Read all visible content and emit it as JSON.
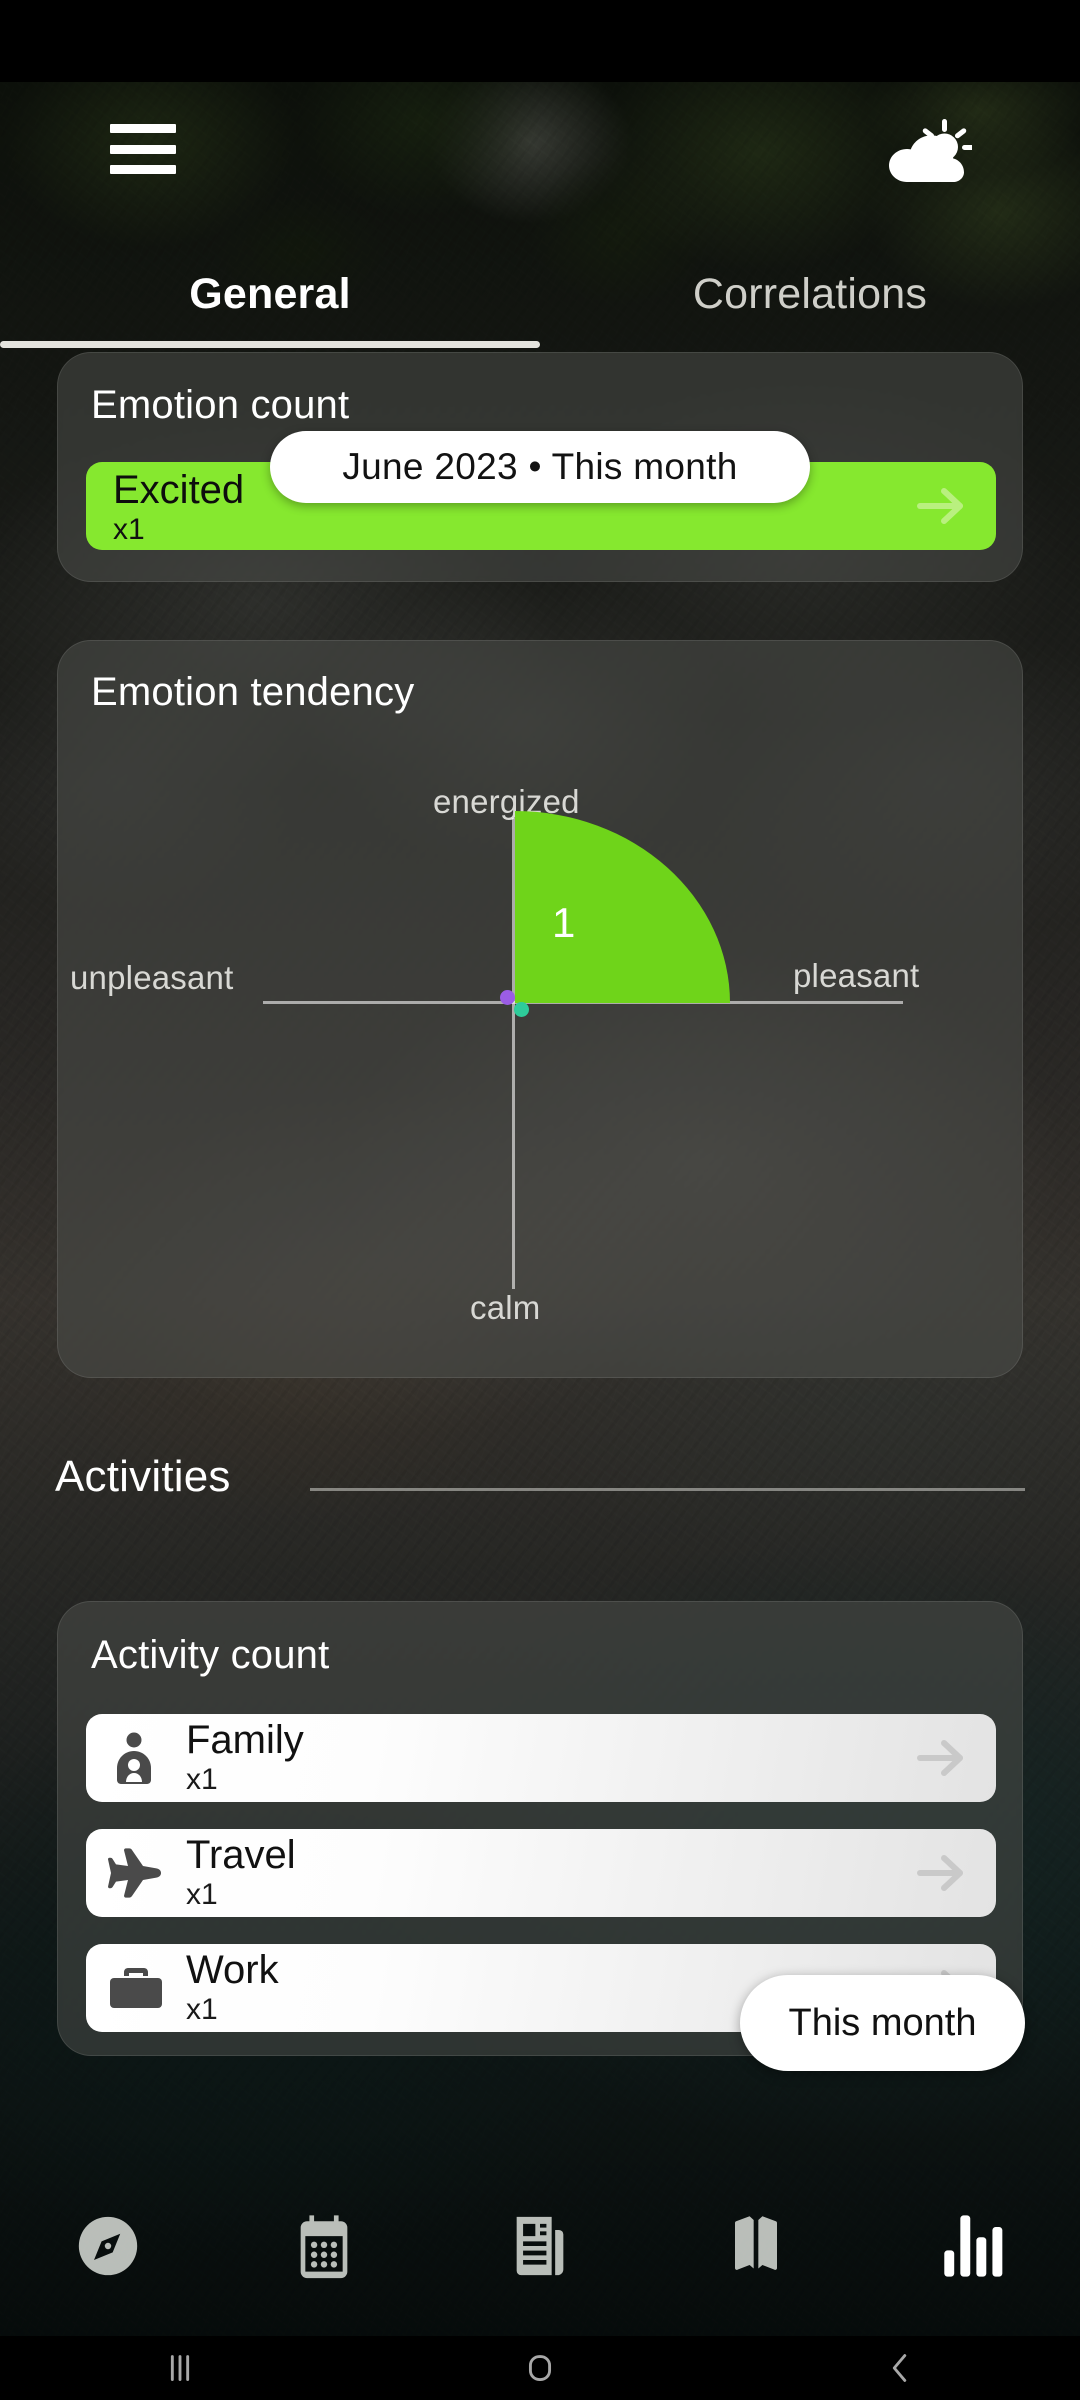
{
  "status_bar": {
    "background": "#000000"
  },
  "header": {
    "menu_icon": "hamburger-menu-icon",
    "weather_icon": "partly-cloudy-icon"
  },
  "tabs": {
    "items": [
      {
        "label": "General",
        "active": true
      },
      {
        "label": "Correlations",
        "active": false
      }
    ]
  },
  "emotion_count": {
    "title": "Emotion count",
    "accent_color": "#86e82f",
    "rows": [
      {
        "label": "Excited",
        "count": "x1",
        "arrow_icon": "arrow-right-icon"
      }
    ]
  },
  "date_pill": {
    "text": "June  2023  •  This month"
  },
  "emotion_tendency": {
    "title": "Emotion tendency",
    "axis_labels": {
      "top": "energized",
      "left": "unpleasant",
      "right": "pleasant",
      "bottom": "calm"
    },
    "value": "1",
    "fill_color": "#6fd41a",
    "dot_colors": {
      "purple": "#9b5de5",
      "teal": "#2ecc9a"
    }
  },
  "activities_section": {
    "title": "Activities"
  },
  "activity_count": {
    "title": "Activity count",
    "rows": [
      {
        "name": "Family",
        "count": "x1",
        "icon": "family-person-icon",
        "arrow_icon": "arrow-right-icon"
      },
      {
        "name": "Travel",
        "count": "x1",
        "icon": "airplane-icon",
        "arrow_icon": "arrow-right-icon"
      },
      {
        "name": "Work",
        "count": "x1",
        "icon": "briefcase-icon",
        "arrow_icon": "arrow-right-icon"
      }
    ]
  },
  "period_pill": {
    "text": "This month"
  },
  "bottom_nav": {
    "items": [
      {
        "name": "compass",
        "icon": "compass-icon",
        "active": false
      },
      {
        "name": "calendar",
        "icon": "calendar-icon",
        "active": false
      },
      {
        "name": "entries",
        "icon": "news-article-icon",
        "active": false
      },
      {
        "name": "diary",
        "icon": "open-book-icon",
        "active": false
      },
      {
        "name": "statistics",
        "icon": "bar-chart-icon",
        "active": true
      }
    ]
  },
  "system_nav": {
    "items": [
      {
        "name": "recents",
        "icon": "recents-icon"
      },
      {
        "name": "home",
        "icon": "home-icon"
      },
      {
        "name": "back",
        "icon": "back-chevron-icon"
      }
    ]
  },
  "chart_data": {
    "type": "pie",
    "title": "Emotion tendency",
    "description": "Valence/arousal quadrant chart; a single quarter-disc sector fills the pleasant + energized quadrant.",
    "axes": {
      "x": [
        "unpleasant",
        "pleasant"
      ],
      "y": [
        "calm",
        "energized"
      ]
    },
    "categories": [
      "pleasant-energized",
      "pleasant-calm",
      "unpleasant-energized",
      "unpleasant-calm"
    ],
    "values": [
      1,
      0,
      0,
      0
    ],
    "labels": [
      "1"
    ],
    "colors": [
      "#6fd41a"
    ],
    "legend": "none",
    "grid": false
  }
}
